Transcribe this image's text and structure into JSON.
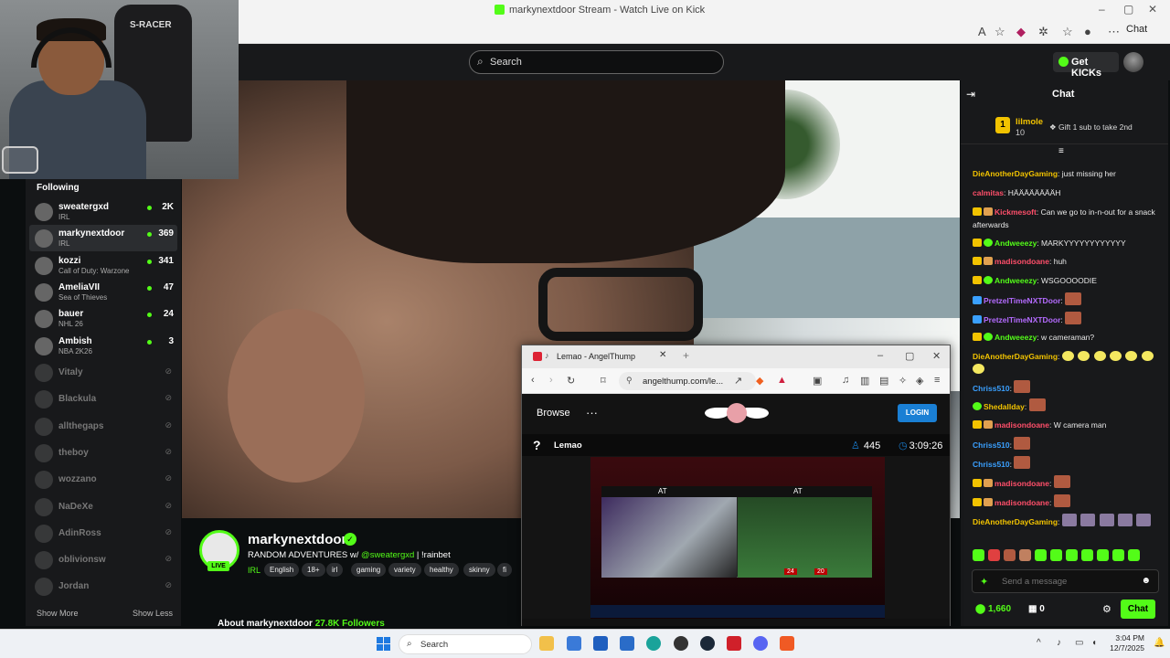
{
  "browser": {
    "window_title": "marky​nextdoor Stream - Watch Live on Kick",
    "chat_button": "Chat"
  },
  "header": {
    "search_placeholder": "Search",
    "get_kicks": "Get KICKs"
  },
  "sidebar": {
    "heading": "Following",
    "live": [
      {
        "name": "sweatergxd",
        "category": "IRL",
        "viewers": "2K"
      },
      {
        "name": "markynextdoor",
        "category": "IRL",
        "viewers": "369",
        "active": true
      },
      {
        "name": "kozzi",
        "category": "Call of Duty: Warzone",
        "viewers": "341"
      },
      {
        "name": "AmeliaVII",
        "category": "Sea of Thieves",
        "viewers": "47"
      },
      {
        "name": "bauer",
        "category": "NHL 26",
        "viewers": "24"
      },
      {
        "name": "Ambish",
        "category": "NBA 2K26",
        "viewers": "3"
      }
    ],
    "offline": [
      "Vitaly",
      "Blackula",
      "allthegaps",
      "theboy",
      "wozzano",
      "NaDeXe",
      "AdinRoss",
      "oblivionsw",
      "Jordan"
    ],
    "show_more": "Show More",
    "show_less": "Show Less"
  },
  "stream": {
    "channel": "markynextdoor",
    "live_badge": "LIVE",
    "title_prefix": "RANDOM ADVENTURES w/ ",
    "title_mention": "@sweatergxd",
    "title_suffix": " | !rainbet",
    "category": "IRL",
    "tags": [
      "English",
      "18+",
      "irl",
      "gaming",
      "variety",
      "healthy",
      "skinny",
      "fi"
    ],
    "about": "About markynextdoor",
    "followers": "27.8K Followers"
  },
  "chat": {
    "title": "Chat",
    "leader_rank": "1",
    "leader_user": "lilmole",
    "leader_count": "10",
    "gift_text": "Gift 1 sub to take 2nd",
    "messages": [
      {
        "user": "DieAnotherDayGaming",
        "color": "#f2c300",
        "text": "just missing her"
      },
      {
        "user": "calmitas",
        "color": "#ff4f6a",
        "text": "HÄÄÄÄÄÄÄÄH"
      },
      {
        "user": "Kickmesoft",
        "color": "#ff4f6a",
        "text": "Can we go to in-n-out for a snack afterwards"
      },
      {
        "user": "Andweeezy",
        "color": "#53fc18",
        "text": "MARKYYYYYYYYYYYY"
      },
      {
        "user": "madisondoane",
        "color": "#ff4f6a",
        "text": "huh"
      },
      {
        "user": "Andweeezy",
        "color": "#53fc18",
        "text": "WSGOOOODIE"
      },
      {
        "user": "PretzelTimeNXTDoor",
        "color": "#b46bff",
        "text": ""
      },
      {
        "user": "PretzelTimeNXTDoor",
        "color": "#b46bff",
        "text": ""
      },
      {
        "user": "Andweeezy",
        "color": "#53fc18",
        "text": "w cameraman?"
      },
      {
        "user": "DieAnotherDayGaming",
        "color": "#f2c300",
        "text": ""
      },
      {
        "user": "Chriss510",
        "color": "#3aa0ff",
        "text": ""
      },
      {
        "user": "Shedallday",
        "color": "#f2c300",
        "text": ""
      },
      {
        "user": "madisondoane",
        "color": "#ff4f6a",
        "text": "W camera man"
      },
      {
        "user": "Chriss510",
        "color": "#3aa0ff",
        "text": ""
      },
      {
        "user": "Chriss510",
        "color": "#3aa0ff",
        "text": ""
      },
      {
        "user": "madisondoane",
        "color": "#ff4f6a",
        "text": ""
      },
      {
        "user": "madisondoane",
        "color": "#ff4f6a",
        "text": ""
      },
      {
        "user": "DieAnotherDayGaming",
        "color": "#f2c300",
        "text": ""
      }
    ],
    "input_placeholder": "Send a message",
    "points": "1,660",
    "store_count": "0",
    "send": "Chat"
  },
  "popup": {
    "tab_title": "Lemao - AngelThump",
    "url": "angelthump.com/le...",
    "browse": "Browse",
    "login": "LOGIN",
    "streamer": "Lemao",
    "viewers": "445",
    "uptime": "3:09:26",
    "score_at_1": "AT",
    "score_at_2": "AT",
    "score_24": "24",
    "score_20": "20"
  },
  "taskbar": {
    "search": "Search",
    "time": "3:04 PM",
    "date": "12/7/2025"
  },
  "colors": {
    "accent": "#53fc18",
    "bg": "#0b0e0f",
    "panel": "#18191b"
  }
}
